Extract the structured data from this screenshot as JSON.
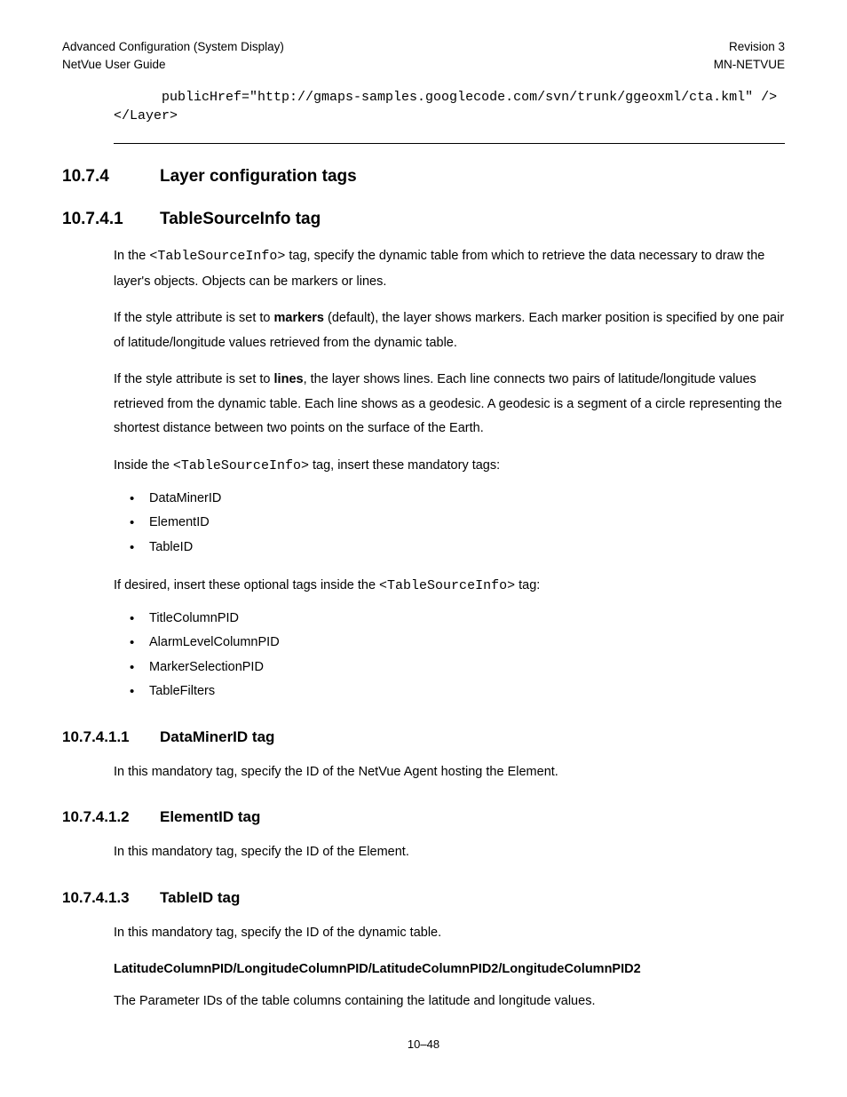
{
  "header": {
    "left1": "Advanced Configuration (System Display)",
    "right1": "Revision 3",
    "left2": "NetVue User Guide",
    "right2": "MN-NETVUE"
  },
  "code": {
    "line1": "      publicHref=\"http://gmaps-samples.googlecode.com/svn/trunk/ggeoxml/cta.kml\" />",
    "line2": "</Layer>"
  },
  "sections": {
    "s1_num": "10.7.4",
    "s1_title": "Layer configuration tags",
    "s2_num": "10.7.4.1",
    "s2_title": "TableSourceInfo tag",
    "s3_num": "10.7.4.1.1",
    "s3_title": "DataMinerID tag",
    "s4_num": "10.7.4.1.2",
    "s4_title": "ElementID tag",
    "s5_num": "10.7.4.1.3",
    "s5_title": "TableID tag"
  },
  "para": {
    "p1a": "In the ",
    "p1code": "<TableSourceInfo>",
    "p1b": " tag, specify the dynamic table from which to retrieve the data necessary to draw the layer's objects. Objects can be markers or lines.",
    "p2a": "If the style attribute is set to ",
    "p2bold": "markers",
    "p2b": " (default), the layer shows markers. Each marker position is specified by one pair of latitude/longitude values retrieved from the dynamic table.",
    "p3a": "If the style attribute is set to ",
    "p3bold": "lines",
    "p3b": ", the layer shows lines. Each line connects two pairs of latitude/longitude values retrieved from the dynamic table. Each line shows as a geodesic. A geodesic is a segment of a circle representing the shortest distance between two points on the surface of the Earth.",
    "p4a": "Inside the ",
    "p4code": "<TableSourceInfo>",
    "p4b": " tag, insert these mandatory tags:",
    "p5a": "If desired, insert these optional tags inside the ",
    "p5code": "<TableSourceInfo>",
    "p5b": " tag:",
    "p6": "In this mandatory tag, specify the ID of the NetVue Agent hosting the Element.",
    "p7": "In this mandatory tag, specify the ID of the Element.",
    "p8": "In this mandatory tag, specify the ID of the dynamic table.",
    "p9bold": "LatitudeColumnPID/LongitudeColumnPID/LatitudeColumnPID2/LongitudeColumnPID2",
    "p10": "The Parameter IDs of the table columns containing the latitude and longitude values."
  },
  "lists": {
    "mandatory": [
      "DataMinerID",
      "ElementID",
      "TableID"
    ],
    "optional": [
      "TitleColumnPID",
      "AlarmLevelColumnPID",
      "MarkerSelectionPID",
      "TableFilters"
    ]
  },
  "footer": "10–48"
}
